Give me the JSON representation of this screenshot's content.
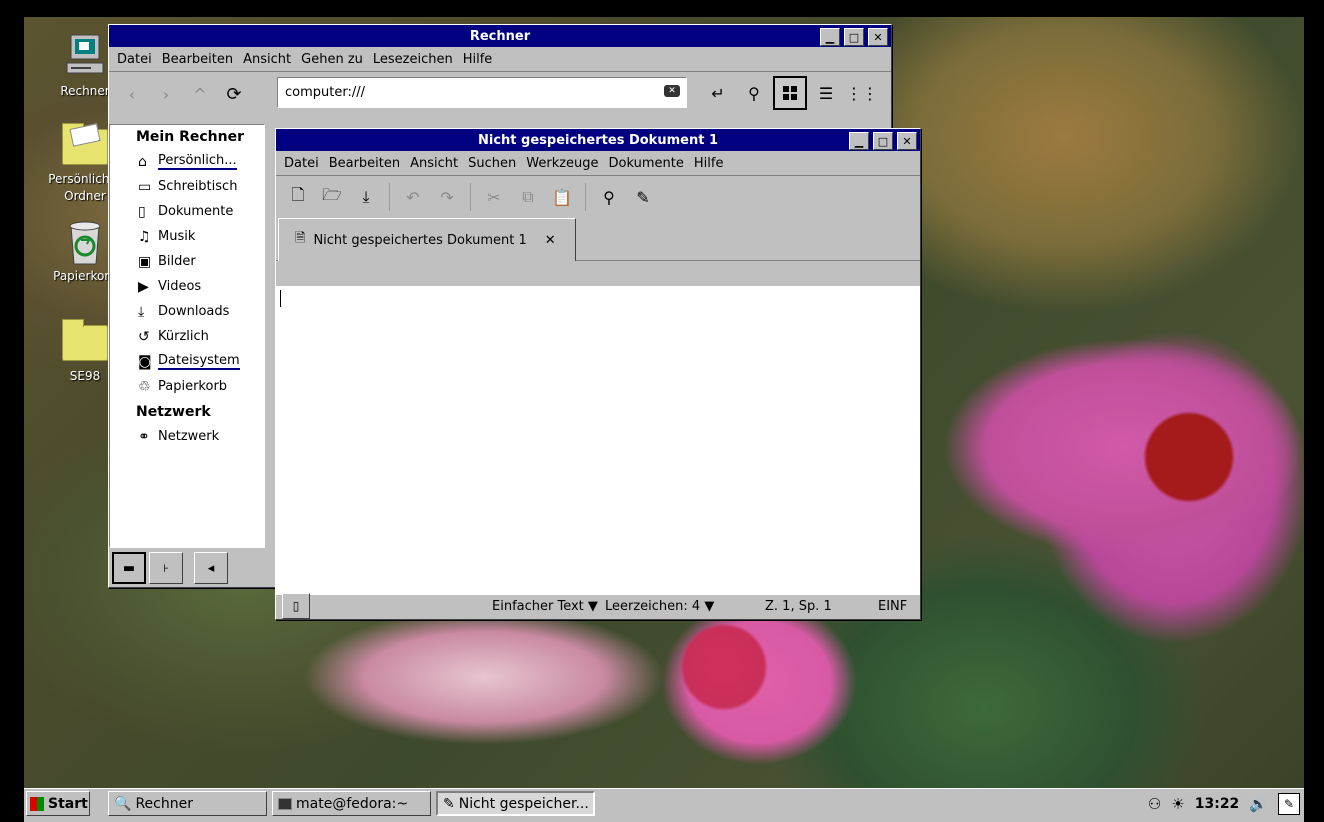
{
  "desktop": {
    "icons": [
      {
        "label": "Rechner",
        "icon": "computer-icon"
      },
      {
        "label": "Persönlicher Ordner",
        "icon": "home-folder-icon"
      },
      {
        "label": "Papierkorb",
        "icon": "trash-icon"
      },
      {
        "label": "SE98",
        "icon": "folder-icon"
      }
    ]
  },
  "filemanager": {
    "title": "Rechner",
    "menu": [
      "Datei",
      "Bearbeiten",
      "Ansicht",
      "Gehen zu",
      "Lesezeichen",
      "Hilfe"
    ],
    "location": "computer:///",
    "sidebar": {
      "sections": [
        {
          "heading": "Mein Rechner",
          "items": [
            {
              "label": "Persönlich...",
              "icon": "home-icon"
            },
            {
              "label": "Schreibtisch",
              "icon": "desktop-icon"
            },
            {
              "label": "Dokumente",
              "icon": "document-icon"
            },
            {
              "label": "Musik",
              "icon": "music-icon"
            },
            {
              "label": "Bilder",
              "icon": "image-icon"
            },
            {
              "label": "Videos",
              "icon": "video-icon"
            },
            {
              "label": "Downloads",
              "icon": "download-icon"
            },
            {
              "label": "Kürzlich",
              "icon": "recent-icon"
            },
            {
              "label": "Dateisystem",
              "icon": "drive-icon"
            },
            {
              "label": "Papierkorb",
              "icon": "trash-icon"
            }
          ]
        },
        {
          "heading": "Netzwerk",
          "items": [
            {
              "label": "Netzwerk",
              "icon": "network-icon"
            }
          ]
        }
      ]
    }
  },
  "editor": {
    "title": "Nicht gespeichertes Dokument 1",
    "menu": [
      "Datei",
      "Bearbeiten",
      "Ansicht",
      "Suchen",
      "Werkzeuge",
      "Dokumente",
      "Hilfe"
    ],
    "tab_label": "Nicht gespeichertes Dokument 1",
    "status": {
      "syntax": "Einfacher Text",
      "indent": "Leerzeichen: 4",
      "position": "Z. 1, Sp. 1",
      "mode": "EINF"
    }
  },
  "taskbar": {
    "start": "Start",
    "tasks": [
      {
        "label": "Rechner"
      },
      {
        "label": "mate@fedora:~"
      },
      {
        "label": "Nicht gespeicher..."
      }
    ],
    "clock": "13:22"
  }
}
